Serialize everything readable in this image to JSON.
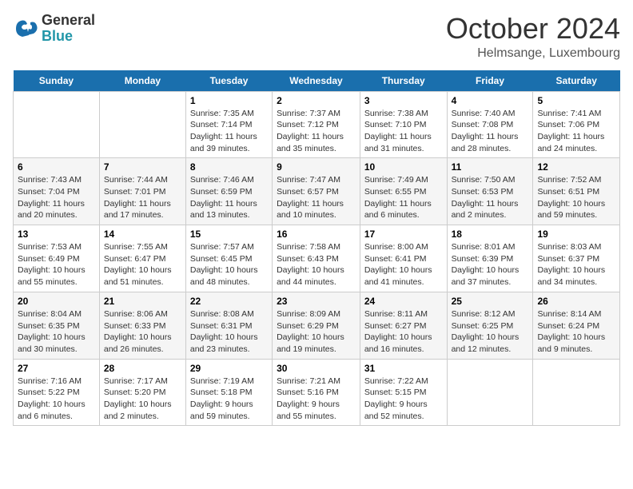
{
  "header": {
    "logo_line1": "General",
    "logo_line2": "Blue",
    "month_year": "October 2024",
    "location": "Helmsange, Luxembourg"
  },
  "weekdays": [
    "Sunday",
    "Monday",
    "Tuesday",
    "Wednesday",
    "Thursday",
    "Friday",
    "Saturday"
  ],
  "weeks": [
    [
      {
        "day": "",
        "info": ""
      },
      {
        "day": "",
        "info": ""
      },
      {
        "day": "1",
        "info": "Sunrise: 7:35 AM\nSunset: 7:14 PM\nDaylight: 11 hours and 39 minutes."
      },
      {
        "day": "2",
        "info": "Sunrise: 7:37 AM\nSunset: 7:12 PM\nDaylight: 11 hours and 35 minutes."
      },
      {
        "day": "3",
        "info": "Sunrise: 7:38 AM\nSunset: 7:10 PM\nDaylight: 11 hours and 31 minutes."
      },
      {
        "day": "4",
        "info": "Sunrise: 7:40 AM\nSunset: 7:08 PM\nDaylight: 11 hours and 28 minutes."
      },
      {
        "day": "5",
        "info": "Sunrise: 7:41 AM\nSunset: 7:06 PM\nDaylight: 11 hours and 24 minutes."
      }
    ],
    [
      {
        "day": "6",
        "info": "Sunrise: 7:43 AM\nSunset: 7:04 PM\nDaylight: 11 hours and 20 minutes."
      },
      {
        "day": "7",
        "info": "Sunrise: 7:44 AM\nSunset: 7:01 PM\nDaylight: 11 hours and 17 minutes."
      },
      {
        "day": "8",
        "info": "Sunrise: 7:46 AM\nSunset: 6:59 PM\nDaylight: 11 hours and 13 minutes."
      },
      {
        "day": "9",
        "info": "Sunrise: 7:47 AM\nSunset: 6:57 PM\nDaylight: 11 hours and 10 minutes."
      },
      {
        "day": "10",
        "info": "Sunrise: 7:49 AM\nSunset: 6:55 PM\nDaylight: 11 hours and 6 minutes."
      },
      {
        "day": "11",
        "info": "Sunrise: 7:50 AM\nSunset: 6:53 PM\nDaylight: 11 hours and 2 minutes."
      },
      {
        "day": "12",
        "info": "Sunrise: 7:52 AM\nSunset: 6:51 PM\nDaylight: 10 hours and 59 minutes."
      }
    ],
    [
      {
        "day": "13",
        "info": "Sunrise: 7:53 AM\nSunset: 6:49 PM\nDaylight: 10 hours and 55 minutes."
      },
      {
        "day": "14",
        "info": "Sunrise: 7:55 AM\nSunset: 6:47 PM\nDaylight: 10 hours and 51 minutes."
      },
      {
        "day": "15",
        "info": "Sunrise: 7:57 AM\nSunset: 6:45 PM\nDaylight: 10 hours and 48 minutes."
      },
      {
        "day": "16",
        "info": "Sunrise: 7:58 AM\nSunset: 6:43 PM\nDaylight: 10 hours and 44 minutes."
      },
      {
        "day": "17",
        "info": "Sunrise: 8:00 AM\nSunset: 6:41 PM\nDaylight: 10 hours and 41 minutes."
      },
      {
        "day": "18",
        "info": "Sunrise: 8:01 AM\nSunset: 6:39 PM\nDaylight: 10 hours and 37 minutes."
      },
      {
        "day": "19",
        "info": "Sunrise: 8:03 AM\nSunset: 6:37 PM\nDaylight: 10 hours and 34 minutes."
      }
    ],
    [
      {
        "day": "20",
        "info": "Sunrise: 8:04 AM\nSunset: 6:35 PM\nDaylight: 10 hours and 30 minutes."
      },
      {
        "day": "21",
        "info": "Sunrise: 8:06 AM\nSunset: 6:33 PM\nDaylight: 10 hours and 26 minutes."
      },
      {
        "day": "22",
        "info": "Sunrise: 8:08 AM\nSunset: 6:31 PM\nDaylight: 10 hours and 23 minutes."
      },
      {
        "day": "23",
        "info": "Sunrise: 8:09 AM\nSunset: 6:29 PM\nDaylight: 10 hours and 19 minutes."
      },
      {
        "day": "24",
        "info": "Sunrise: 8:11 AM\nSunset: 6:27 PM\nDaylight: 10 hours and 16 minutes."
      },
      {
        "day": "25",
        "info": "Sunrise: 8:12 AM\nSunset: 6:25 PM\nDaylight: 10 hours and 12 minutes."
      },
      {
        "day": "26",
        "info": "Sunrise: 8:14 AM\nSunset: 6:24 PM\nDaylight: 10 hours and 9 minutes."
      }
    ],
    [
      {
        "day": "27",
        "info": "Sunrise: 7:16 AM\nSunset: 5:22 PM\nDaylight: 10 hours and 6 minutes."
      },
      {
        "day": "28",
        "info": "Sunrise: 7:17 AM\nSunset: 5:20 PM\nDaylight: 10 hours and 2 minutes."
      },
      {
        "day": "29",
        "info": "Sunrise: 7:19 AM\nSunset: 5:18 PM\nDaylight: 9 hours and 59 minutes."
      },
      {
        "day": "30",
        "info": "Sunrise: 7:21 AM\nSunset: 5:16 PM\nDaylight: 9 hours and 55 minutes."
      },
      {
        "day": "31",
        "info": "Sunrise: 7:22 AM\nSunset: 5:15 PM\nDaylight: 9 hours and 52 minutes."
      },
      {
        "day": "",
        "info": ""
      },
      {
        "day": "",
        "info": ""
      }
    ]
  ]
}
